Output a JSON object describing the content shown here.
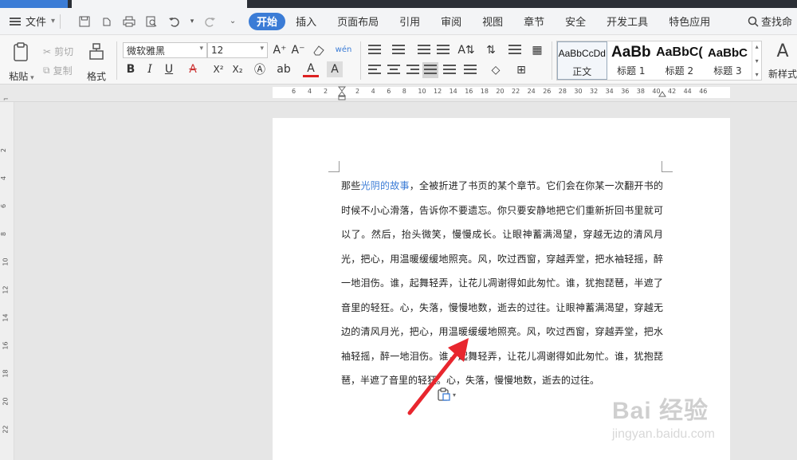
{
  "menu": {
    "file_label": "文件",
    "tabs": [
      "开始",
      "插入",
      "页面布局",
      "引用",
      "审阅",
      "视图",
      "章节",
      "安全",
      "开发工具",
      "特色应用"
    ],
    "active_tab": "开始",
    "search_label": "查找命"
  },
  "ribbon": {
    "paste_label": "粘贴",
    "cut_label": "剪切",
    "copy_label": "复制",
    "format_painter_label": "格式刷",
    "font_name": "微软雅黑",
    "font_size": "12",
    "bold": "B",
    "italic": "I",
    "underline": "U",
    "font_color": "A",
    "superscript": "X²",
    "subscript": "X₂",
    "styles": [
      {
        "sample": "AaBbCcDd",
        "name": "正文"
      },
      {
        "sample": "AaBb",
        "name": "标题 1"
      },
      {
        "sample": "AaBbC(",
        "name": "标题 2"
      },
      {
        "sample": "AaBbC",
        "name": "标题 3"
      }
    ],
    "new_style_label": "新样式",
    "new_style_sample": "A"
  },
  "ruler": {
    "left_numbers": [
      "6",
      "4",
      "2"
    ],
    "right_numbers": [
      "2",
      "4",
      "6",
      "8",
      "10",
      "12",
      "14",
      "16",
      "18",
      "20",
      "22",
      "24",
      "26",
      "28",
      "30",
      "32",
      "34",
      "36",
      "38",
      "40",
      "42",
      "44",
      "46"
    ],
    "vertical_numbers": [
      "2",
      "4",
      "6",
      "8",
      "10",
      "12",
      "14",
      "16",
      "18",
      "20",
      "22"
    ]
  },
  "document": {
    "link_text": "光阴的故事",
    "pre_link": "那些",
    "post_link": "，全被折进了书页的某个章节。它们会在你某一次翻开书的时候不小心滑落，告诉你不要遗忘。你只要安静地把它们重新折回书里就可以了。然后，抬头微笑，慢慢成长。让眼神蓄满渴望，穿越无边的清风月光，把心，用温暖缓缓地照亮。风，吹过西窗，穿越弄堂，把水袖轻摇，醉一地泪伤。谁，起舞轻弄，让花儿凋谢得如此匆忙。谁，犹抱琵琶，半遮了音里的轻狂。心，失落，慢慢地数，逝去的过往。让眼神蓄满渴望，穿越无边的清风月光，把心，用温暖缓缓地照亮。风，吹过西窗，穿越弄堂，把水袖轻摇，醉一地泪伤。谁，起舞轻弄，让花儿凋谢得如此匆忙。谁，犹抱琵琶，半遮了音里的轻狂。心，失落，慢慢地数，逝去的过往。"
  },
  "watermark": {
    "main": "Bai 经验",
    "sub": "jingyan.baidu.com"
  },
  "colors": {
    "accent": "#3b7cd6",
    "arrow": "#e8262e"
  }
}
